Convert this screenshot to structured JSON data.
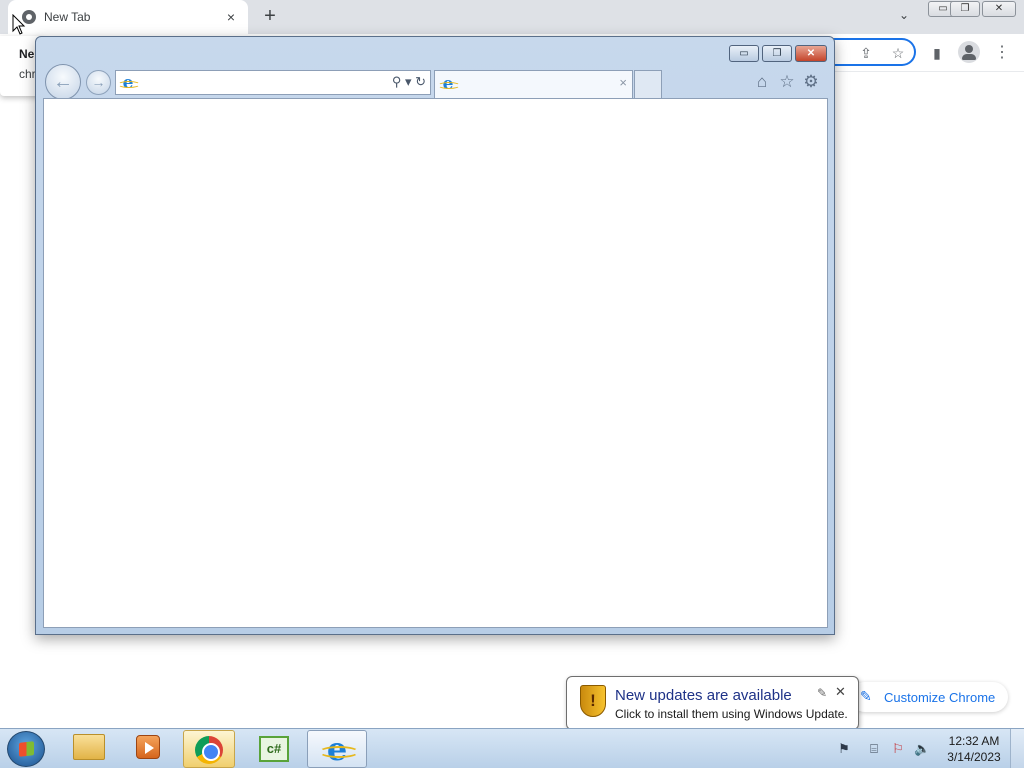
{
  "chrome": {
    "tab_title": "New Tab",
    "tab_close": "×",
    "new_tab": "+",
    "tab_search": "⌄",
    "window_controls": {
      "minimize": "▭",
      "restore": "❐",
      "close": "✕"
    },
    "toolbar_icons": {
      "share": "⇪",
      "bookmark": "☆",
      "side_panel": "▮",
      "menu": "⋮"
    },
    "popup_line1": "Ne",
    "popup_line2": "chr",
    "customize_label": "Customize Chrome"
  },
  "ie": {
    "caption": {
      "minimize": "▭",
      "restore": "❐",
      "close": "✕"
    },
    "back": "←",
    "forward": "→",
    "address_value": "",
    "address_tools": "⚲ ▾ ↻",
    "tab_title": "",
    "tab_close": "×",
    "toolbar": {
      "home": "⌂",
      "favorites": "☆",
      "tools": "⚙"
    }
  },
  "notification": {
    "title": "New updates are available",
    "text": "Click to install them using Windows Update.",
    "options": "✎",
    "close": "✕"
  },
  "taskbar": {
    "apps": [
      "Windows Explorer",
      "Windows Media Player",
      "Google Chrome",
      "C# project",
      "Internet Explorer"
    ],
    "csharp_label": "c#",
    "tray_time": "12:32 AM",
    "tray_date": "3/14/2023"
  }
}
